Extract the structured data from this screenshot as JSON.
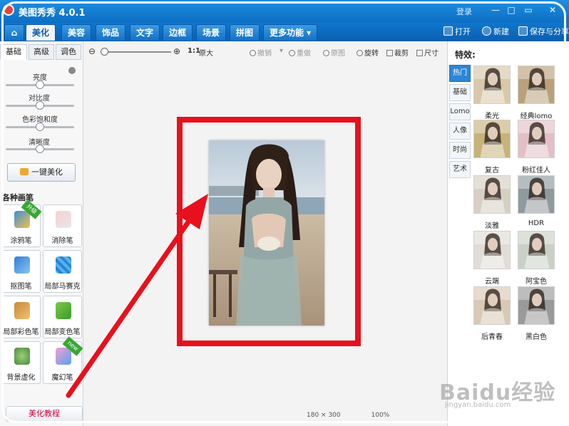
{
  "app": {
    "title": "美图秀秀 4.0.1",
    "login": "登录"
  },
  "tabs": [
    {
      "label": "⌂"
    },
    {
      "label": "美化"
    },
    {
      "label": "美容"
    },
    {
      "label": "饰品"
    },
    {
      "label": "文字"
    },
    {
      "label": "边框"
    },
    {
      "label": "场景"
    },
    {
      "label": "拼图"
    },
    {
      "label": "更多功能 ▾"
    }
  ],
  "top_actions": {
    "open": "打开",
    "new": "新建",
    "save": "保存与分享"
  },
  "left_panel": {
    "subtabs": [
      "基础",
      "高级",
      "调色"
    ],
    "adjust": [
      {
        "label": "亮度",
        "value": 0.5
      },
      {
        "label": "对比度",
        "value": 0.5
      },
      {
        "label": "色彩饱和度",
        "value": 0.5
      },
      {
        "label": "清晰度",
        "value": 0.5
      }
    ],
    "one_key": "一键美化",
    "brushes_title": "各种画笔",
    "brushes": [
      {
        "label": "涂鸦笔",
        "badge": "升级"
      },
      {
        "label": "消除笔",
        "badge": ""
      },
      {
        "label": "抠图笔",
        "badge": ""
      },
      {
        "label": "局部马赛克",
        "badge": ""
      },
      {
        "label": "局部彩色笔",
        "badge": ""
      },
      {
        "label": "局部变色笔",
        "badge": ""
      },
      {
        "label": "背景虚化",
        "badge": ""
      },
      {
        "label": "魔幻笔",
        "badge": "new"
      }
    ],
    "tutorial": "美化教程"
  },
  "toolbar": {
    "ratio": "1:1",
    "original_size": "原大",
    "undo": "撤销",
    "redo": "重做",
    "reset": "原图",
    "rotate": "旋转",
    "crop": "裁剪",
    "resize": "尺寸"
  },
  "effects": {
    "title": "特效:",
    "categories": [
      "热门",
      "基础",
      "Lomo",
      "人像",
      "时尚",
      "艺术"
    ],
    "items": [
      {
        "label": "柔光",
        "tone": "#d8c7a8"
      },
      {
        "label": "经典lomo",
        "tone": "#b9a27a"
      },
      {
        "label": "复古",
        "tone": "#c7b27a"
      },
      {
        "label": "粉红佳人",
        "tone": "#e2c0c6"
      },
      {
        "label": "淡雅",
        "tone": "#d6d0c4"
      },
      {
        "label": "HDR",
        "tone": "#8e9a9e"
      },
      {
        "label": "云端",
        "tone": "#e1dcd6"
      },
      {
        "label": "阿宝色",
        "tone": "#c9d1c6"
      },
      {
        "label": "后青春",
        "tone": "#d7c9b3"
      },
      {
        "label": "黑白色",
        "tone": "#9a9a9a"
      }
    ]
  },
  "status": {
    "dimensions": "180 × 300",
    "zoom": "100%"
  },
  "watermark": {
    "text": "Baidu经验",
    "sub": "jingyan.baidu.com"
  }
}
